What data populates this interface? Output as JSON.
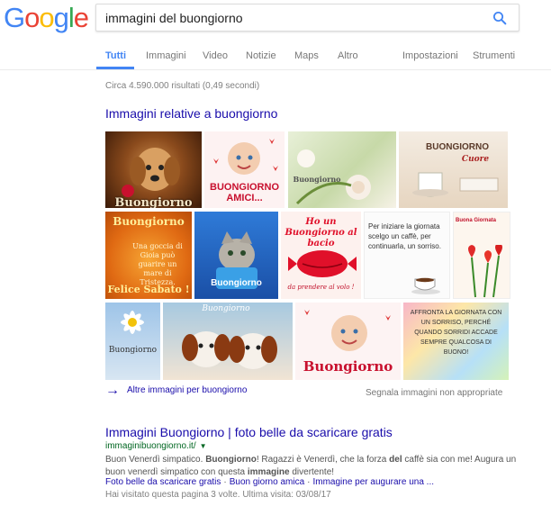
{
  "logo": {
    "letters": [
      "G",
      "o",
      "o",
      "g",
      "l",
      "e"
    ],
    "colors": [
      "#4285f4",
      "#ea4335",
      "#fbbc05",
      "#4285f4",
      "#34a853",
      "#ea4335"
    ]
  },
  "search": {
    "query": "immagini del buongiorno",
    "button_icon": "search-icon"
  },
  "tabs": [
    {
      "label": "Tutti",
      "active": true
    },
    {
      "label": "Immagini"
    },
    {
      "label": "Video"
    },
    {
      "label": "Notizie"
    },
    {
      "label": "Maps"
    },
    {
      "label": "Altro"
    },
    {
      "label": "Impostazioni"
    },
    {
      "label": "Strumenti"
    }
  ],
  "stats": "Circa 4.590.000 risultati (0,49 secondi)",
  "images_section": {
    "heading": "Immagini relative a buongiorno",
    "thumbs": [
      {
        "caption": "Buongiorno"
      },
      {
        "caption": "BUONGIORNO AMICI..."
      },
      {
        "caption": "Buongiorno"
      },
      {
        "caption": "BUONGIORNO",
        "sub": "Cuore"
      },
      {
        "caption": "Buongiorno",
        "line2": "Una goccia di Gioia può guarire un mare di Tristezza.",
        "line3": "Felice Sabato !"
      },
      {
        "caption": "Buongiorno"
      },
      {
        "caption": "Ho un Buongiorno al bacio",
        "sub": "da prendere al volo !"
      },
      {
        "caption": "Per iniziare la giornata scelgo un caffè, per continuarla, un sorriso."
      },
      {
        "caption": "Buona Giornata"
      },
      {
        "caption": "Buongiorno"
      },
      {
        "caption": "Buongiorno"
      },
      {
        "caption": "Buongiorno"
      },
      {
        "caption": "AFFRONTA LA GIORNATA CON UN SORRISO, PERCHÉ QUANDO SORRIDI ACCADE SEMPRE QUALCOSA DI BUONO!"
      }
    ],
    "more_label": "Altre immagini per buongiorno",
    "report_label": "Segnala immagini non appropriate"
  },
  "result": {
    "title": "Immagini Buongiorno | foto belle da scaricare gratis",
    "url": "immaginibuongiorno.it/",
    "snippet_parts": [
      "Buon Venerdì simpatico. ",
      "Buongiorno",
      "! Ragazzi è Venerdì, che la forza ",
      "del",
      " caffè sia con me! Augura un buon venerdì simpatico con questa ",
      "immagine",
      " divertente!"
    ],
    "sitelinks": [
      "Foto belle da scaricare gratis",
      "Buon giorno amica",
      "Immagine per augurare una ..."
    ],
    "visited": "Hai visitato questa pagina 3 volte. Ultima visita: 03/08/17"
  }
}
